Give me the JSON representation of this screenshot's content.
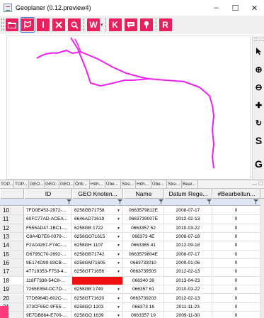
{
  "window": {
    "title": "Geoplaner (0.12.preview4)",
    "controls": {
      "minimize": "–",
      "maximize": "☐",
      "close": "✕"
    }
  },
  "toolbar": {
    "accent": "#e8205e",
    "selected_accent": "#3a78c8",
    "buttons": [
      {
        "icon": "folder-icon",
        "label": ""
      },
      {
        "icon": "waypoint-flag-icon",
        "label": ""
      },
      {
        "icon": "text-cursor-icon",
        "label": "I"
      },
      {
        "icon": "cross-icon",
        "label": ""
      },
      {
        "icon": "search-icon",
        "label": ""
      },
      {
        "icon": "web-icon",
        "label": "W"
      },
      {
        "icon": "kml-icon",
        "label": "K"
      },
      {
        "icon": "chat-icon",
        "label": ""
      },
      {
        "icon": "info-icon",
        "label": ""
      },
      {
        "icon": "route-icon",
        "label": "R"
      }
    ]
  },
  "side_toolbar": {
    "tools": [
      {
        "icon": "pointer-icon",
        "label": "▲"
      },
      {
        "icon": "zoom-in-icon",
        "label": "⊕"
      },
      {
        "icon": "zoom-out-icon",
        "label": "⊖"
      },
      {
        "icon": "pan-icon",
        "label": "✚"
      },
      {
        "icon": "rotate-icon",
        "label": "↻"
      },
      {
        "icon": "s-tool-icon",
        "label": "S"
      },
      {
        "icon": "g-tool-icon",
        "label": "G"
      }
    ]
  },
  "map": {
    "track_color": "#ee22ee"
  },
  "tabs": [
    "TOP...",
    "TOP...",
    "GEO...",
    "GEO...",
    "GEO...",
    "Örtli...",
    "Höh...",
    "Übe...",
    "Stre...",
    "Höh...",
    "Übe...",
    "Stre...",
    "Bear..."
  ],
  "tab_controls": {
    "pin": "—",
    "close": "☐"
  },
  "grid": {
    "columns": [
      "ID",
      "GEO Knoten...",
      "Name",
      "Datum Rege...",
      "#Bearbeitun..."
    ],
    "highlight_color": "#ee1010",
    "rows": [
      {
        "n": "10",
        "id": "7FD0E453-2972-...",
        "geo": "6258GB71758",
        "name": "0663579812E",
        "date": "2008-07-17",
        "count": "0"
      },
      {
        "n": "11",
        "id": "60FC77AD-ACEA...",
        "geo": "6646AD71619",
        "name": "0663739007E",
        "date": "2012-02-13",
        "count": "0"
      },
      {
        "n": "12",
        "id": "F555AD47-1BC1-...",
        "geo": "6258GB 1722",
        "name": "0663357 52",
        "date": "2010-03-22",
        "count": "0"
      },
      {
        "n": "13",
        "id": "C8A4D7E6-0379-...",
        "geo": "6258GO71615",
        "name": "066373 4E",
        "date": "2008-07-18",
        "count": "0"
      },
      {
        "n": "14",
        "id": "F2A04267-F74C-...",
        "geo": "6258GH 1107",
        "name": "0663365 41",
        "date": "2012-09-18",
        "count": "0"
      },
      {
        "n": "15",
        "id": "D6795C70-2692-...",
        "geo": "6258GB71742",
        "name": "0663579804E",
        "date": "2008-07-17",
        "count": "0"
      },
      {
        "n": "16",
        "id": "9E174D99-93CB-...",
        "geo": "6258GM71605",
        "name": "0663733010",
        "date": "2009-01-06",
        "count": "0"
      },
      {
        "n": "17",
        "id": "47719353-F753-4...",
        "geo": "6258GT71656",
        "name": "0663739505",
        "date": "2012-02-13",
        "count": "0"
      },
      {
        "n": "18",
        "id": "118F7338-54C8-...",
        "geo": "",
        "name": "066340 39",
        "date": "2013-04-23",
        "count": "0",
        "highlight": true
      },
      {
        "n": "19",
        "id": "7265E854-DC7D-...",
        "geo": "6258GB 1749",
        "name": "066357 61",
        "date": "2010-03-22",
        "count": "0"
      },
      {
        "n": "20",
        "id": "77D6964D-802C-...",
        "geo": "6258GT71620",
        "name": "0663739203",
        "date": "2012-02-13",
        "count": "0"
      },
      {
        "n": "21",
        "id": "373CF65C-9F55-...",
        "geo": "6258GO 1203",
        "name": "066373 16",
        "date": "2011-11-23",
        "count": "0"
      },
      {
        "n": "22",
        "id": "9E7DB864-E700-...",
        "geo": "6258GO 1639",
        "name": "0663357 19",
        "date": "2009-11-30",
        "count": "0"
      }
    ]
  }
}
